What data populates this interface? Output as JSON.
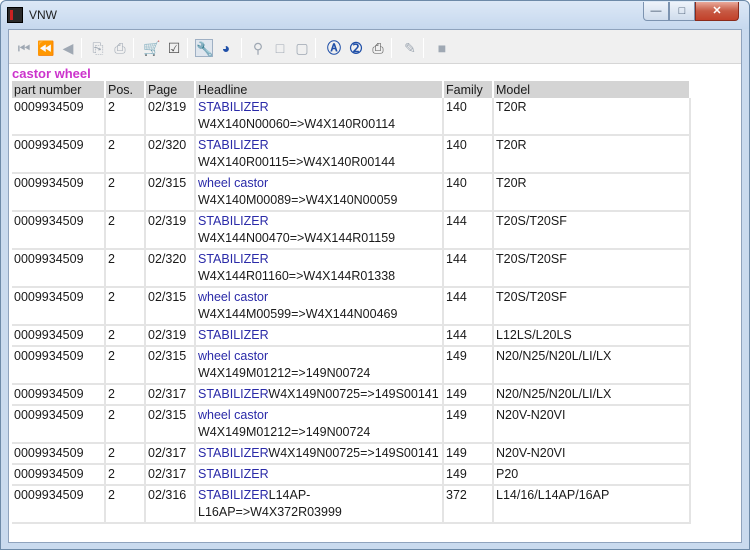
{
  "window": {
    "title": "VNW",
    "app_icon_letter": "5"
  },
  "toolbar": {
    "icons": [
      "first-icon",
      "previous-page-icon",
      "previous-icon",
      "export-icon",
      "import-icon",
      "cart-icon",
      "checklist-icon",
      "wrench-icon",
      "globe-icon",
      "zoom-icon",
      "page-icon",
      "page-alt-icon",
      "a-circle-icon",
      "two-circle-icon",
      "print-icon",
      "edit-icon",
      "stop-icon"
    ]
  },
  "search": {
    "title": "castor wheel"
  },
  "table": {
    "headers": {
      "part": "part number",
      "pos": "Pos.",
      "page": "Page",
      "headline": "Headline",
      "family": "Family",
      "model": "Model"
    },
    "rows": [
      {
        "part": "0009934509",
        "pos": "2",
        "page": "02/319",
        "head_link": "STABILIZER",
        "head_text": "",
        "head_sub": "W4X140N00060=>W4X140R00114",
        "family": "140",
        "model": "T20R"
      },
      {
        "part": "0009934509",
        "pos": "2",
        "page": "02/320",
        "head_link": "STABILIZER",
        "head_text": "",
        "head_sub": "W4X140R00115=>W4X140R00144",
        "family": "140",
        "model": "T20R"
      },
      {
        "part": "0009934509",
        "pos": "2",
        "page": "02/315",
        "head_link": "wheel castor",
        "head_text": "",
        "head_sub": "W4X140M00089=>W4X140N00059",
        "family": "140",
        "model": "T20R"
      },
      {
        "part": "0009934509",
        "pos": "2",
        "page": "02/319",
        "head_link": "STABILIZER",
        "head_text": "",
        "head_sub": "W4X144N00470=>W4X144R01159",
        "family": "144",
        "model": "T20S/T20SF"
      },
      {
        "part": "0009934509",
        "pos": "2",
        "page": "02/320",
        "head_link": "STABILIZER",
        "head_text": "",
        "head_sub": "W4X144R01160=>W4X144R01338",
        "family": "144",
        "model": "T20S/T20SF"
      },
      {
        "part": "0009934509",
        "pos": "2",
        "page": "02/315",
        "head_link": "wheel castor",
        "head_text": "",
        "head_sub": "W4X144M00599=>W4X144N00469",
        "family": "144",
        "model": "T20S/T20SF"
      },
      {
        "part": "0009934509",
        "pos": "2",
        "page": "02/319",
        "head_link": "STABILIZER",
        "head_text": "",
        "head_sub": "",
        "family": "144",
        "model": "L12LS/L20LS"
      },
      {
        "part": "0009934509",
        "pos": "2",
        "page": "02/315",
        "head_link": "wheel castor",
        "head_text": "",
        "head_sub": "W4X149M01212=>149N00724",
        "family": "149",
        "model": "N20/N25/N20L/LI/LX"
      },
      {
        "part": "0009934509",
        "pos": "2",
        "page": "02/317",
        "head_link": "STABILIZER",
        "head_text": "W4X149N00725=>149S00141",
        "head_sub": "",
        "family": "149",
        "model": "N20/N25/N20L/LI/LX"
      },
      {
        "part": "0009934509",
        "pos": "2",
        "page": "02/315",
        "head_link": "wheel castor",
        "head_text": "",
        "head_sub": "W4X149M01212=>149N00724",
        "family": "149",
        "model": "N20V-N20VI"
      },
      {
        "part": "0009934509",
        "pos": "2",
        "page": "02/317",
        "head_link": "STABILIZER",
        "head_text": "W4X149N00725=>149S00141",
        "head_sub": "",
        "family": "149",
        "model": "N20V-N20VI"
      },
      {
        "part": "0009934509",
        "pos": "2",
        "page": "02/317",
        "head_link": "STABILIZER",
        "head_text": "",
        "head_sub": "",
        "family": "149",
        "model": "P20"
      },
      {
        "part": "0009934509",
        "pos": "2",
        "page": "02/316",
        "head_link": "STABILIZER",
        "head_text": "L14AP-",
        "head_sub": "L16AP=>W4X372R03999",
        "family": "372",
        "model": "L14/16/L14AP/16AP"
      }
    ]
  }
}
